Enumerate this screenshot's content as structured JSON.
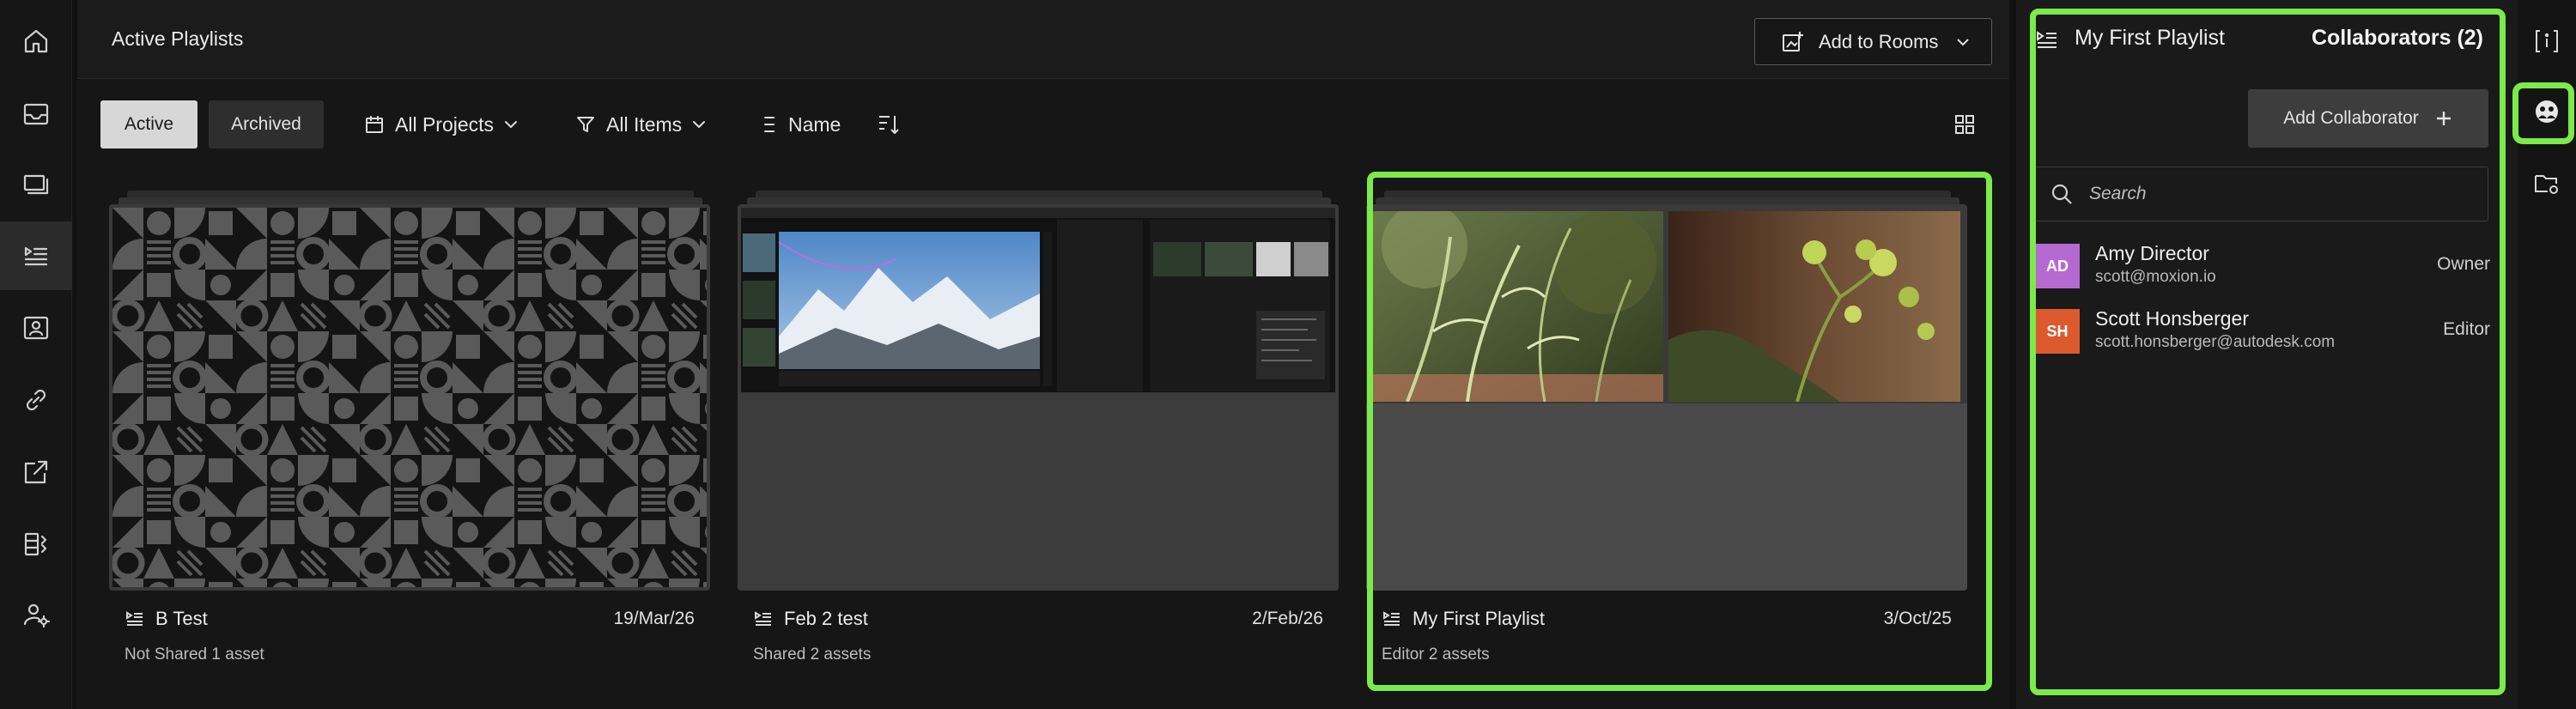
{
  "header": {
    "title": "Active Playlists",
    "add_to_rooms": "Add to Rooms"
  },
  "toolbar": {
    "active": "Active",
    "archived": "Archived",
    "projects_filter": "All Projects",
    "items_filter": "All Items",
    "sort_label": "Name"
  },
  "playlists": [
    {
      "name": "B Test",
      "date": "19/Mar/26",
      "share": "Not Shared",
      "assets": "1 asset"
    },
    {
      "name": "Feb 2 test",
      "date": "2/Feb/26",
      "share": "Shared",
      "assets": "2 assets"
    },
    {
      "name": "My First Playlist",
      "date": "3/Oct/25",
      "share": "Editor",
      "assets": "2 assets"
    }
  ],
  "panel": {
    "title": "My First Playlist",
    "collaborators_label": "Collaborators (2)",
    "add_button": "Add Collaborator",
    "search_placeholder": "Search",
    "collaborators": [
      {
        "initials": "AD",
        "name": "Amy Director",
        "email": "scott@moxion.io",
        "role": "Owner",
        "color": "#b46ad0"
      },
      {
        "initials": "SH",
        "name": "Scott Honsberger",
        "email": "scott.honsberger@autodesk.com",
        "role": "Editor",
        "color": "#dd5a2e"
      }
    ]
  },
  "colors": {
    "highlight": "#7bea4a",
    "background": "#161616"
  },
  "icons": {
    "nav": [
      "home-icon",
      "inbox-icon",
      "review-icon",
      "playlist-icon",
      "contacts-icon",
      "link-icon",
      "share-icon",
      "compare-icon",
      "user-settings-icon"
    ],
    "rail": [
      "info-icon",
      "collaborators-icon",
      "folder-settings-icon"
    ]
  }
}
